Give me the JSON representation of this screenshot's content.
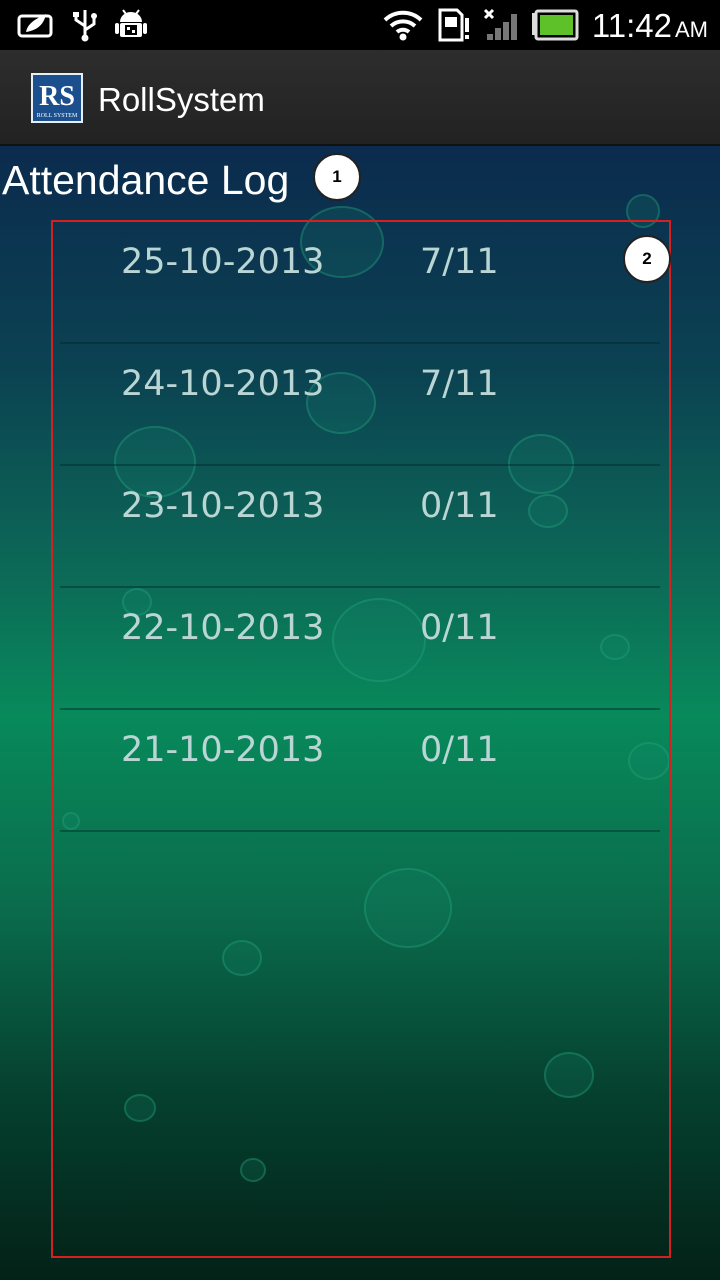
{
  "status_bar": {
    "time": "11:42",
    "ampm": "AM",
    "icons": [
      "leaf-notification-icon",
      "usb-icon",
      "android-debug-icon",
      "wifi-icon",
      "sim-card-alert-icon",
      "no-signal-icon",
      "battery-icon"
    ]
  },
  "action_bar": {
    "logo_letters": "RS",
    "logo_caption": "ROLL SYSTEM",
    "title": "RollSystem"
  },
  "page": {
    "heading": "Attendance Log",
    "callouts": [
      "1",
      "2"
    ]
  },
  "log": [
    {
      "date": "25-10-2013",
      "count": "7/11"
    },
    {
      "date": "24-10-2013",
      "count": "7/11"
    },
    {
      "date": "23-10-2013",
      "count": "0/11"
    },
    {
      "date": "22-10-2013",
      "count": "0/11"
    },
    {
      "date": "21-10-2013",
      "count": "0/11"
    }
  ],
  "colors": {
    "frame": "#d52020",
    "list_text": "#b9d6d4",
    "action_bar": "#2a2a2a"
  }
}
